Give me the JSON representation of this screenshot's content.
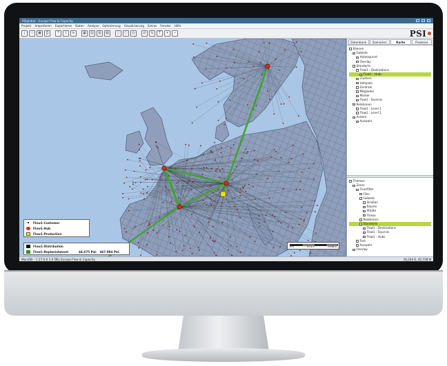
{
  "window": {
    "title": "PSIglobal – Europe Flow & Capacity"
  },
  "menu": [
    "Projekt",
    "Importieren",
    "Exportieren",
    "Daten",
    "Analyse",
    "Optimierung",
    "Visualisierung",
    "Extras",
    "Fenster",
    "Hilfe"
  ],
  "brand": {
    "name": "PSI"
  },
  "panel": {
    "tabs": [
      "Datenbank",
      "Szenarien",
      "Karte",
      "Prozesse"
    ],
    "active_tab": "Karte",
    "layers_tree": [
      {
        "label": "Ebenen",
        "depth": 0
      },
      {
        "label": "Gebiete",
        "depth": 1
      },
      {
        "label": "Hintergrund",
        "depth": 2
      },
      {
        "label": "Overlay",
        "depth": 2
      },
      {
        "label": "Standorte",
        "depth": 1
      },
      {
        "label": "Flow1 : Destinations",
        "depth": 2
      },
      {
        "label": "Flow1 : Hubs",
        "depth": 3,
        "highlight": true
      },
      {
        "label": "Clusters",
        "depth": 2
      },
      {
        "label": "Hotspots",
        "depth": 2
      },
      {
        "label": "Zentrale",
        "depth": 2
      },
      {
        "label": "Mitglieder",
        "depth": 2
      },
      {
        "label": "Marker",
        "depth": 2
      },
      {
        "label": "Flow1 : Sources",
        "depth": 2
      },
      {
        "label": "Relationen",
        "depth": 1
      },
      {
        "label": "Flow1 : Level 1",
        "depth": 2
      },
      {
        "label": "Flow1 : Level 2",
        "depth": 2
      },
      {
        "label": "Andere",
        "depth": 1
      },
      {
        "label": "Auswahl",
        "depth": 2
      }
    ],
    "themes_tree": [
      {
        "label": "Themen",
        "depth": 0
      },
      {
        "label": "Zoom",
        "depth": 1
      },
      {
        "label": "Flussfilter",
        "depth": 2
      },
      {
        "label": "Files",
        "depth": 3
      },
      {
        "label": "Gebiete",
        "depth": 3
      },
      {
        "label": "Straßen",
        "depth": 4
      },
      {
        "label": "Räume",
        "depth": 4
      },
      {
        "label": "Städte",
        "depth": 4
      },
      {
        "label": "Flüsse",
        "depth": 4
      },
      {
        "label": "Relationen",
        "depth": 3
      },
      {
        "label": "Standorte",
        "depth": 3,
        "highlight": true
      },
      {
        "label": "Flow1 : Destinations",
        "depth": 4
      },
      {
        "label": "Flow1 : Sources",
        "depth": 4
      },
      {
        "label": "Flow1 : Hubs",
        "depth": 4
      },
      {
        "label": "Text",
        "depth": 2
      },
      {
        "label": "Auswahl",
        "depth": 2
      },
      {
        "label": "Overlay",
        "depth": 1
      }
    ]
  },
  "legend_top": [
    {
      "label": "Flow1-Customer",
      "color": "#222222",
      "kind": "dot-small"
    },
    {
      "label": "Flow1-Hub",
      "color": "#d42a1e",
      "kind": "dot"
    },
    {
      "label": "Flow1-Production",
      "color": "#f2e600",
      "kind": "square"
    }
  ],
  "legend_bottom": [
    {
      "label": "Flow1-Distribution",
      "color": "#111111",
      "value_left": "",
      "value_right": ""
    },
    {
      "label": "Flow1-Replenishment",
      "color": "#2f8f1f",
      "value_left": "44.675 Pal.",
      "value_right": "467.994 Pal."
    }
  ],
  "scalebar": {
    "labels": [
      "km",
      "974,2",
      "1948,4"
    ]
  },
  "status": {
    "left": "MarsDB – 1.27.0.0 1.0 DEL Europe Flow & Capacity",
    "right": "16,244 E, 42,728 N"
  },
  "colors": {
    "land": "#8f9fbb",
    "sea": "#a9c6e6",
    "route": "#3fa52a",
    "hub": "#d42a1e",
    "highlight": "#b7d740"
  }
}
